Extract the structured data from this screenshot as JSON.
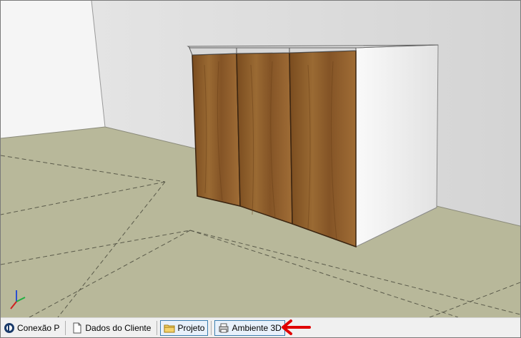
{
  "taskbar": {
    "items": [
      {
        "label": "Conexão P",
        "icon": "app-logo-icon"
      },
      {
        "label": "Dados do Cliente",
        "icon": "document-icon"
      },
      {
        "label": "Projeto",
        "icon": "folder-icon"
      },
      {
        "label": "Ambiente 3D",
        "icon": "3d-printer-icon"
      }
    ]
  },
  "colors": {
    "floor": "#b8b89a",
    "wall_left": "#f4f4f4",
    "wall_back": "#dddddd",
    "wood": "#8a5a28",
    "cabinet_side": "#efefef",
    "annotation_arrow": "#e00000",
    "active_tab_border": "#3c7fb1"
  },
  "annotation": {
    "type": "arrow",
    "points_to": "Ambiente 3D"
  }
}
